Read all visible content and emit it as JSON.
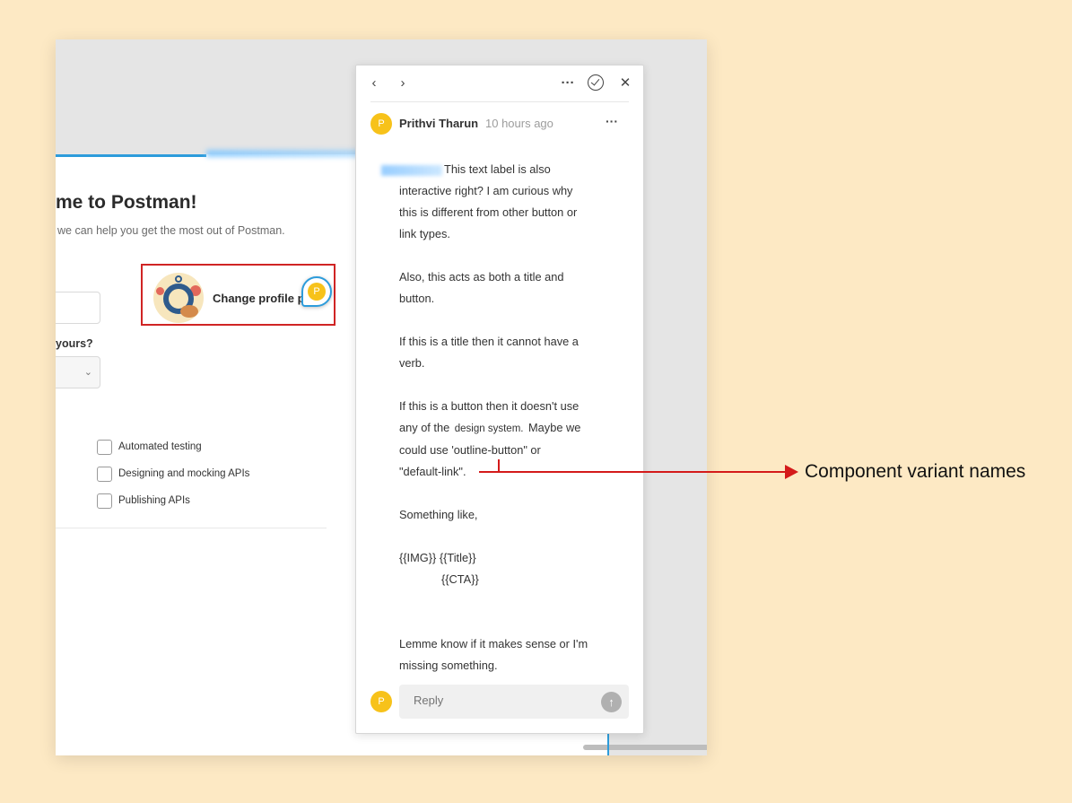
{
  "canvas": {
    "welcome_title": "me to Postman!",
    "welcome_subtitle": "we can help you get the most out of Postman.",
    "question_label": "yours?",
    "profile_button_label": "Change profile p",
    "comment_pin_initial": "P",
    "select_chevron": "⌄",
    "interests": [
      {
        "label": "Automated testing",
        "checked": false
      },
      {
        "label": "Designing and mocking APIs",
        "checked": false
      },
      {
        "label": "Publishing APIs",
        "checked": false
      }
    ]
  },
  "comment_panel": {
    "nav_prev": "‹",
    "nav_next": "›",
    "more": "···",
    "close": "✕",
    "author": {
      "initial": "P",
      "name": "Prithvi Tharun",
      "time": "10 hours ago"
    },
    "body": {
      "p1": [
        "This text label is also",
        "interactive right? I am curious why",
        "this is different from other button or",
        "link types."
      ],
      "p2": [
        "Also, this acts as both a title and",
        "button."
      ],
      "p3": [
        "If this is a title then it cannot have a",
        "verb."
      ],
      "p4_line1": "If this is a button then it doesn't use",
      "p4_line2_before": "any of the ",
      "p4_line2_inline": "design system.",
      "p4_line2_after": " Maybe we",
      "p4_line3": "could use 'outline-button\" or",
      "p4_line4": "\"default-link\".",
      "p5": "Something like,",
      "p6_line1": "{{IMG}} {{Title}}",
      "p6_line2": "{{CTA}}",
      "p7": [
        "Lemme know if it makes sense or I'm",
        "missing something."
      ]
    },
    "reply": {
      "initial": "P",
      "placeholder": "Reply",
      "send_icon": "↑"
    }
  },
  "annotation": {
    "label": "Component variant names",
    "color": "#d41a1a"
  },
  "colors": {
    "background": "#fde9c4",
    "accent_blue": "#2d9cdb",
    "avatar_yellow": "#f7c21a",
    "highlight_red": "#d02424"
  }
}
